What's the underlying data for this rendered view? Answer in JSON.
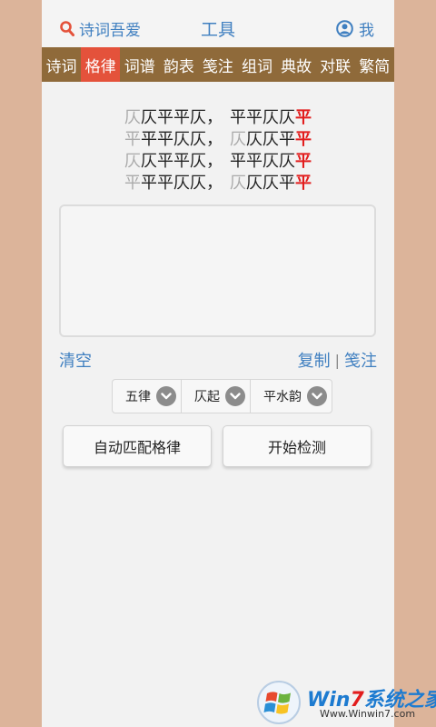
{
  "header": {
    "search_label": "诗词吾爱",
    "title": "工具",
    "me_label": "我"
  },
  "nav": {
    "tabs": [
      "诗词",
      "格律",
      "词谱",
      "韵表",
      "笺注",
      "组词",
      "典故",
      "对联",
      "繁简"
    ],
    "active_index": 1
  },
  "meter": {
    "lines": [
      {
        "left": [
          [
            "仄",
            "light"
          ],
          [
            "仄",
            "dark"
          ],
          [
            "平",
            "dark"
          ],
          [
            "平",
            "dark"
          ],
          [
            "仄",
            "dark"
          ]
        ],
        "sep": "，",
        "right": [
          [
            "平",
            "dark"
          ],
          [
            "平",
            "dark"
          ],
          [
            "仄",
            "dark"
          ],
          [
            "仄",
            "dark"
          ],
          [
            "平",
            "red"
          ]
        ]
      },
      {
        "left": [
          [
            "平",
            "light"
          ],
          [
            "平",
            "dark"
          ],
          [
            "平",
            "dark"
          ],
          [
            "仄",
            "dark"
          ],
          [
            "仄",
            "dark"
          ]
        ],
        "sep": "，",
        "right": [
          [
            "仄",
            "light"
          ],
          [
            "仄",
            "dark"
          ],
          [
            "仄",
            "dark"
          ],
          [
            "平",
            "dark"
          ],
          [
            "平",
            "red"
          ]
        ]
      },
      {
        "left": [
          [
            "仄",
            "light"
          ],
          [
            "仄",
            "dark"
          ],
          [
            "平",
            "dark"
          ],
          [
            "平",
            "dark"
          ],
          [
            "仄",
            "dark"
          ]
        ],
        "sep": "，",
        "right": [
          [
            "平",
            "dark"
          ],
          [
            "平",
            "dark"
          ],
          [
            "仄",
            "dark"
          ],
          [
            "仄",
            "dark"
          ],
          [
            "平",
            "red"
          ]
        ]
      },
      {
        "left": [
          [
            "平",
            "light"
          ],
          [
            "平",
            "dark"
          ],
          [
            "平",
            "dark"
          ],
          [
            "仄",
            "dark"
          ],
          [
            "仄",
            "dark"
          ]
        ],
        "sep": "，",
        "right": [
          [
            "仄",
            "light"
          ],
          [
            "仄",
            "dark"
          ],
          [
            "仄",
            "dark"
          ],
          [
            "平",
            "dark"
          ],
          [
            "平",
            "red"
          ]
        ]
      }
    ]
  },
  "input": {
    "value": "",
    "placeholder": ""
  },
  "actions": {
    "clear": "清空",
    "copy": "复制",
    "divider": "|",
    "annotate": "笺注"
  },
  "selects": [
    {
      "value": "五律"
    },
    {
      "value": "仄起"
    },
    {
      "value": "平水韵"
    }
  ],
  "buttons": {
    "auto_match": "自动匹配格律",
    "start_check": "开始检测"
  },
  "watermark": {
    "title_prefix": "Win",
    "title_seven": "7",
    "title_suffix": "系统之家",
    "subtitle": "Www.Winwin7.com"
  },
  "colors": {
    "accent": "#3f7fc0",
    "nav_bg": "#8f6a3a",
    "nav_active": "#e4523b",
    "rhyme_red": "#e21d1d"
  },
  "icons": {
    "search": "search-icon",
    "user": "user-icon",
    "dropdown": "chevron-down-icon"
  }
}
